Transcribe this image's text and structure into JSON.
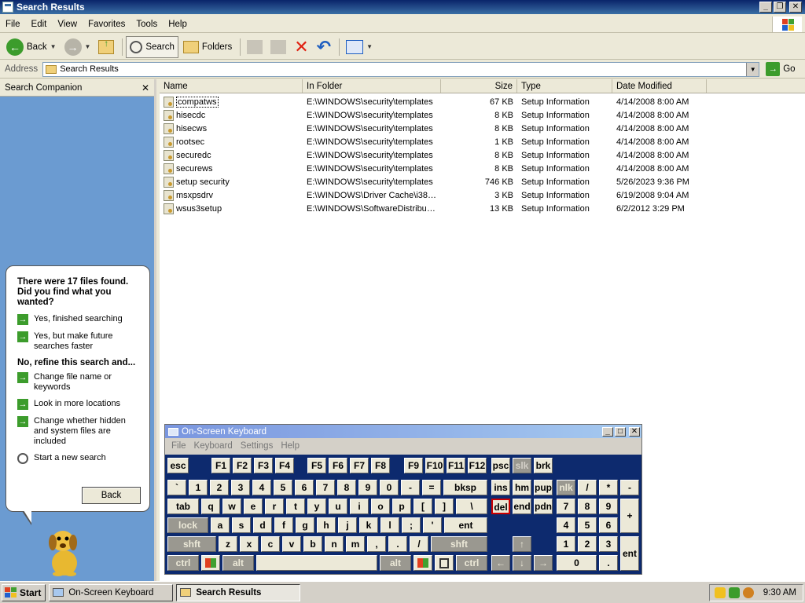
{
  "window": {
    "title": "Search Results"
  },
  "menu": [
    "File",
    "Edit",
    "View",
    "Favorites",
    "Tools",
    "Help"
  ],
  "toolbar": {
    "back": "Back",
    "search": "Search",
    "folders": "Folders"
  },
  "address": {
    "label": "Address",
    "value": "Search Results",
    "go": "Go"
  },
  "companion": {
    "header": "Search Companion",
    "question": "There were 17 files found. Did you find what you wanted?",
    "opt_yes": "Yes, finished searching",
    "opt_yes_faster": "Yes, but make future searches faster",
    "refine_header": "No, refine this search and...",
    "opt_change": "Change file name or keywords",
    "opt_more": "Look in more locations",
    "opt_hidden": "Change whether hidden and system files are included",
    "opt_new": "Start a new search",
    "back": "Back"
  },
  "columns": [
    "Name",
    "In Folder",
    "Size",
    "Type",
    "Date Modified"
  ],
  "files": [
    {
      "name": "compatws",
      "folder": "E:\\WINDOWS\\security\\templates",
      "size": "67 KB",
      "type": "Setup Information",
      "date": "4/14/2008 8:00 AM"
    },
    {
      "name": "hisecdc",
      "folder": "E:\\WINDOWS\\security\\templates",
      "size": "8 KB",
      "type": "Setup Information",
      "date": "4/14/2008 8:00 AM"
    },
    {
      "name": "hisecws",
      "folder": "E:\\WINDOWS\\security\\templates",
      "size": "8 KB",
      "type": "Setup Information",
      "date": "4/14/2008 8:00 AM"
    },
    {
      "name": "rootsec",
      "folder": "E:\\WINDOWS\\security\\templates",
      "size": "1 KB",
      "type": "Setup Information",
      "date": "4/14/2008 8:00 AM"
    },
    {
      "name": "securedc",
      "folder": "E:\\WINDOWS\\security\\templates",
      "size": "8 KB",
      "type": "Setup Information",
      "date": "4/14/2008 8:00 AM"
    },
    {
      "name": "securews",
      "folder": "E:\\WINDOWS\\security\\templates",
      "size": "8 KB",
      "type": "Setup Information",
      "date": "4/14/2008 8:00 AM"
    },
    {
      "name": "setup security",
      "folder": "E:\\WINDOWS\\security\\templates",
      "size": "746 KB",
      "type": "Setup Information",
      "date": "5/26/2023 9:36 PM"
    },
    {
      "name": "msxpsdrv",
      "folder": "E:\\WINDOWS\\Driver Cache\\i386...",
      "size": "3 KB",
      "type": "Setup Information",
      "date": "6/19/2008 9:04 AM"
    },
    {
      "name": "wsus3setup",
      "folder": "E:\\WINDOWS\\SoftwareDistributi...",
      "size": "13 KB",
      "type": "Setup Information",
      "date": "6/2/2012 3:29 PM"
    }
  ],
  "osk": {
    "title": "On-Screen Keyboard",
    "menu": [
      "File",
      "Keyboard",
      "Settings",
      "Help"
    ],
    "keys": {
      "esc": "esc",
      "f1": "F1",
      "f2": "F2",
      "f3": "F3",
      "f4": "F4",
      "f5": "F5",
      "f6": "F6",
      "f7": "F7",
      "f8": "F8",
      "f9": "F9",
      "f10": "F10",
      "f11": "F11",
      "f12": "F12",
      "psc": "psc",
      "slk": "slk",
      "brk": "brk",
      "grave": "`",
      "n1": "1",
      "n2": "2",
      "n3": "3",
      "n4": "4",
      "n5": "5",
      "n6": "6",
      "n7": "7",
      "n8": "8",
      "n9": "9",
      "n0": "0",
      "minus": "-",
      "equal": "=",
      "bksp": "bksp",
      "ins": "ins",
      "hm": "hm",
      "pup": "pup",
      "nlk": "nlk",
      "div": "/",
      "mul": "*",
      "sub": "-",
      "tab": "tab",
      "q": "q",
      "w": "w",
      "e": "e",
      "r": "r",
      "t": "t",
      "y": "y",
      "u": "u",
      "i": "i",
      "o": "o",
      "p": "p",
      "lbr": "[",
      "rbr": "]",
      "bsl": "\\",
      "del": "del",
      "end": "end",
      "pdn": "pdn",
      "p7": "7",
      "p8": "8",
      "p9": "9",
      "plus": "+",
      "lock": "lock",
      "a": "a",
      "s": "s",
      "d": "d",
      "f": "f",
      "g": "g",
      "h": "h",
      "j": "j",
      "k": "k",
      "l": "l",
      "semi": ";",
      "quote": "'",
      "ent": "ent",
      "p4": "4",
      "p5": "5",
      "p6": "6",
      "shftL": "shft",
      "z": "z",
      "x": "x",
      "c": "c",
      "v": "v",
      "b": "b",
      "n": "n",
      "m": "m",
      "comma": ",",
      "period": ".",
      "slash": "/",
      "shftR": "shft",
      "up": "↑",
      "p1": "1",
      "p2": "2",
      "p3": "3",
      "pent": "ent",
      "ctrlL": "ctrl",
      "altL": "alt",
      "altR": "alt",
      "ctrlR": "ctrl",
      "left": "←",
      "down": "↓",
      "right": "→",
      "p0": "0",
      "pdot": "."
    }
  },
  "taskbar": {
    "start": "Start",
    "osk": "On-Screen Keyboard",
    "search": "Search Results",
    "clock": "9:30 AM"
  }
}
